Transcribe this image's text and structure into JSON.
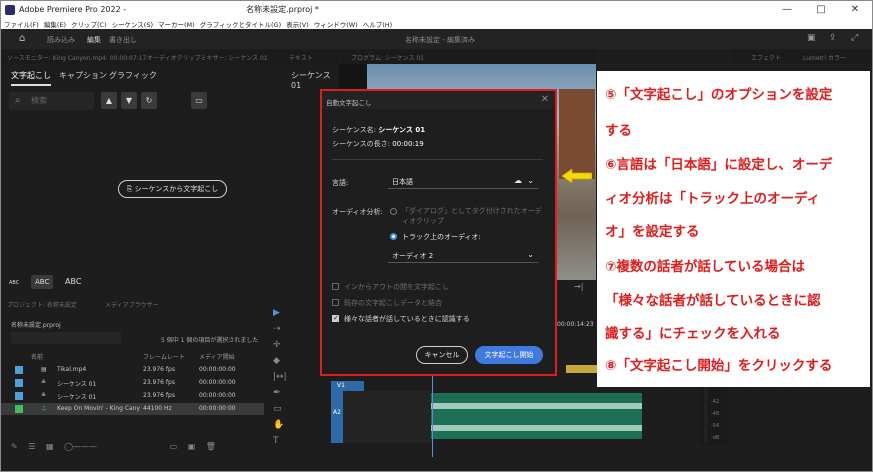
{
  "window": {
    "title": "Adobe Premiere Pro 2022 - ",
    "title_tail": "名称未設定.prproj *",
    "buttons": [
      "—",
      "□",
      "✕"
    ]
  },
  "menu": [
    "ファイル(F)",
    "編集(E)",
    "クリップ(C)",
    "シーケンス(S)",
    "マーカー(M)",
    "グラフィックとタイトル(G)",
    "表示(V)",
    "ウィンドウ(W)",
    "ヘルプ(H)"
  ],
  "workspace": {
    "tabs": [
      "読み込み",
      "編集",
      "書き出し"
    ],
    "center": "名称未設定 - 編集済み"
  },
  "panel_tabs": {
    "left": "ソースモニター: King Canyon.mp4: 00:00:07:17",
    "left2": "オーディオクリップミキサー: シーケンス 01",
    "left3": "テキスト",
    "program": "プログラム: シーケンス 01",
    "right1": "エフェクト",
    "right2": "Lumetri カラー"
  },
  "transcript": {
    "subtabs": [
      "文字起こし",
      "キャプション",
      "グラフィック"
    ],
    "sequence": "シーケンス 01",
    "search_placeholder": "検索",
    "transcribe_button": "シーケンスから文字起こし",
    "abc": [
      "ABC",
      "ABC",
      "ABC"
    ]
  },
  "project": {
    "tabs": [
      "プロジェクト: 名称未設定",
      "メディアブラウザー"
    ],
    "name": "名称未設定.prproj",
    "selection": "5 個中 1 個の項目が選択されました",
    "columns": [
      "名前",
      "フレームレート",
      "メディア開始"
    ],
    "rows": [
      {
        "name": "Tikal.mp4",
        "fps": "23.976 fps",
        "start": "00:00:00:00",
        "color": "#4aa3d8"
      },
      {
        "name": "シーケンス 01",
        "fps": "23.976 fps",
        "start": "00:00:00:00",
        "color": "#4aa3d8"
      },
      {
        "name": "シーケンス 01",
        "fps": "23.976 fps",
        "start": "00:00:00:00",
        "color": "#4aa3d8"
      },
      {
        "name": "Keep On Movin' - King Cany",
        "fps": "44100 Hz",
        "start": "00:00:00:00",
        "color": "#3fbf5f"
      }
    ]
  },
  "timeline": {
    "timecode": "00:00:14:23",
    "v1": "V1",
    "a2": "A2",
    "meter_labels": [
      "-42",
      "-48",
      "-54",
      "-dB"
    ]
  },
  "dialog": {
    "title": "自動文字起こし",
    "seq_label": "シーケンス名:",
    "seq_value": "シーケンス 01",
    "dur_label": "シーケンスの長さ:",
    "dur_value": "00:00:19",
    "lang_label": "言語:",
    "lang_value": "日本語",
    "audio_label": "オーディオ分析:",
    "radio1": "「ダイアログ」としてタグ付けされたオーディオクリップ",
    "radio2": "トラック上のオーディオ:",
    "track_value": "オーディオ 2",
    "chk1": "インからアウトの間を文字起こし",
    "chk2": "既存の文字起こしデータと結合",
    "chk3": "様々な話者が話しているときに認識する",
    "cancel": "キャンセル",
    "start": "文字起こし開始"
  },
  "annotation": {
    "lines": [
      "⑤「文字起こし」のオプションを設定",
      "する",
      "⑥言語は「日本語」に設定し、オーデ",
      "ィオ分析は「トラック上のオーディ",
      "オ」を設定する",
      "⑦複数の話者が話している場合は",
      "「様々な話者が話しているときに認",
      "識する」にチェックを入れる",
      "⑧「文字起こし開始」をクリックする"
    ],
    "color": "#e21b1b"
  }
}
